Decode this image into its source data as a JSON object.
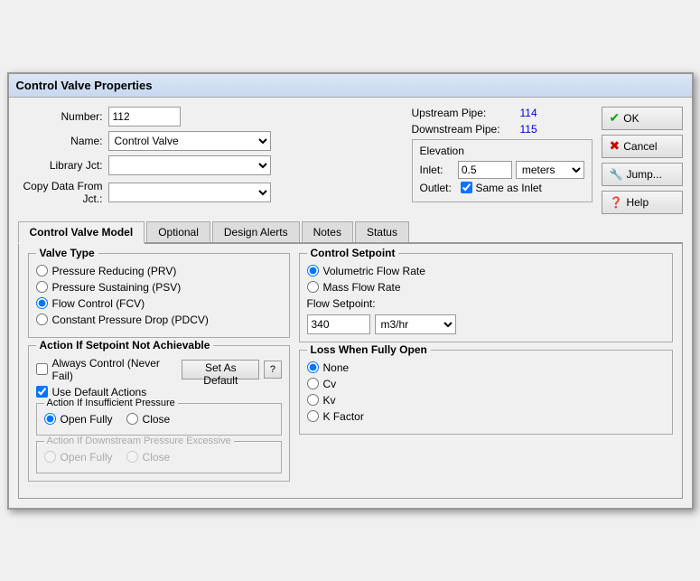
{
  "title": "Control Valve Properties",
  "fields": {
    "number_label": "Number:",
    "number_value": "112",
    "name_label": "Name:",
    "name_value": "Control Valve",
    "library_jct_label": "Library Jct:",
    "copy_data_label": "Copy Data From Jct.:"
  },
  "pipes": {
    "upstream_label": "Upstream Pipe:",
    "upstream_value": "114",
    "downstream_label": "Downstream Pipe:",
    "downstream_value": "115"
  },
  "elevation": {
    "title": "Elevation",
    "inlet_label": "Inlet:",
    "inlet_value": "0.5",
    "inlet_unit": "meters",
    "outlet_label": "Outlet:",
    "same_as_inlet": "Same as Inlet"
  },
  "buttons": {
    "ok": "OK",
    "cancel": "Cancel",
    "jump": "Jump...",
    "help": "Help"
  },
  "tabs": {
    "items": [
      {
        "label": "Control Valve Model",
        "active": true
      },
      {
        "label": "Optional",
        "active": false
      },
      {
        "label": "Design Alerts",
        "active": false
      },
      {
        "label": "Notes",
        "active": false
      },
      {
        "label": "Status",
        "active": false
      }
    ]
  },
  "valve_type": {
    "title": "Valve Type",
    "options": [
      {
        "label": "Pressure Reducing (PRV)",
        "checked": false
      },
      {
        "label": "Pressure Sustaining (PSV)",
        "checked": false
      },
      {
        "label": "Flow Control (FCV)",
        "checked": true
      },
      {
        "label": "Constant Pressure Drop (PDCV)",
        "checked": false
      }
    ]
  },
  "control_setpoint": {
    "title": "Control Setpoint",
    "options": [
      {
        "label": "Volumetric Flow Rate",
        "checked": true
      },
      {
        "label": "Mass Flow Rate",
        "checked": false
      }
    ],
    "flow_setpoint_label": "Flow Setpoint:",
    "flow_value": "340",
    "flow_unit": "m3/hr"
  },
  "action_setpoint": {
    "title": "Action If Setpoint Not Achievable",
    "always_control_label": "Always Control (Never Fail)",
    "set_as_default": "Set As Default",
    "help_q": "?",
    "use_default_label": "Use Default Actions",
    "insufficient_pressure_title": "Action If Insufficient Pressure",
    "open_fully_label": "Open Fully",
    "close_label": "Close",
    "downstream_title": "Action If Downstream Pressure Excessive",
    "open_fully2_label": "Open Fully",
    "close2_label": "Close"
  },
  "loss_fully_open": {
    "title": "Loss When Fully Open",
    "options": [
      {
        "label": "None",
        "checked": true
      },
      {
        "label": "Cv",
        "checked": false
      },
      {
        "label": "Kv",
        "checked": false
      },
      {
        "label": "K Factor",
        "checked": false
      }
    ]
  }
}
